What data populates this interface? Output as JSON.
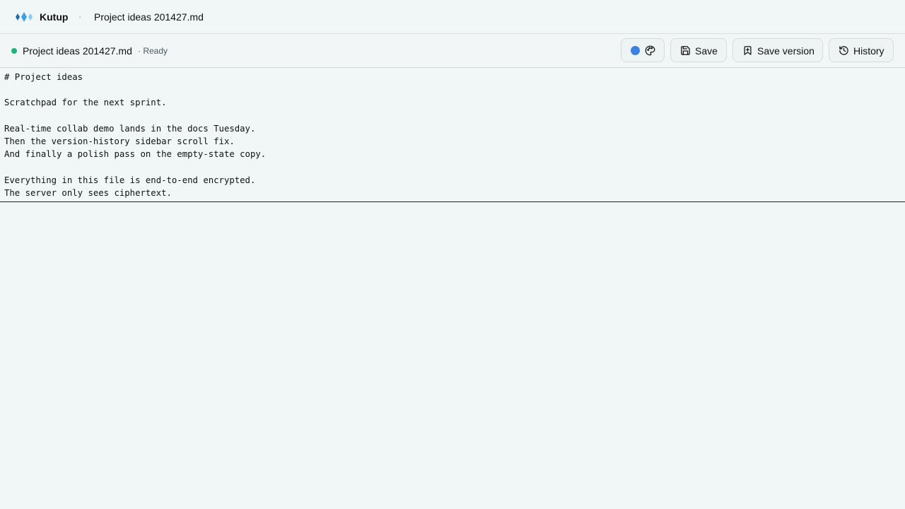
{
  "app": {
    "brand": "Kutup",
    "separator": "·",
    "title_doc": "Project ideas 201427.md"
  },
  "document": {
    "name": "Project ideas 201427.md",
    "status": "· Ready",
    "status_color": "#19b87a"
  },
  "toolbar": {
    "theme_color": "#3b82e8",
    "theme_icon": "palette-icon",
    "save_label": "Save",
    "save_icon": "floppy-disk-icon",
    "save_version_label": "Save version",
    "save_version_icon": "bookmark-plus-icon",
    "history_label": "History",
    "history_icon": "history-clock-icon"
  },
  "editor": {
    "content": "# Project ideas\n\nScratchpad for the next sprint.\n\nReal-time collab demo lands in the docs Tuesday.\nThen the version-history sidebar scroll fix.\nAnd finally a polish pass on the empty-state copy.\n\nEverything in this file is end-to-end encrypted.\nThe server only sees ciphertext."
  }
}
